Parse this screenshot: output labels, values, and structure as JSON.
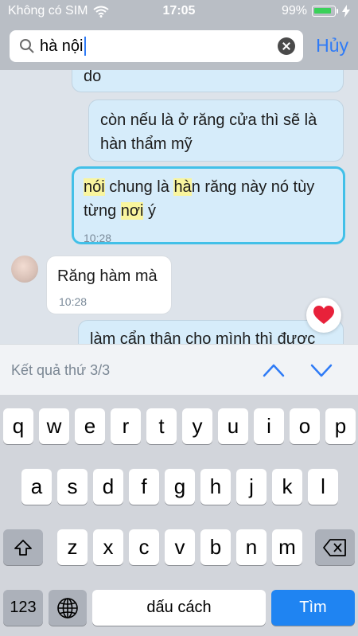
{
  "status": {
    "carrier": "Không có SIM",
    "time": "17:05",
    "battery": "99%"
  },
  "search": {
    "query": "hà nội",
    "cancel_label": "Hủy"
  },
  "messages": [
    {
      "side": "out",
      "text": "do"
    },
    {
      "side": "out",
      "text_line1": "còn nếu là ở răng cửa thì sẽ là",
      "text_line2": "hàn thẩm mỹ"
    },
    {
      "side": "out",
      "selected": true,
      "seg1": "nói",
      "seg2": " chung là ",
      "seg3": "hà",
      "seg4": "n răng này nó tùy",
      "seg5": "từng ",
      "seg6": "nơi",
      "seg7": " ý",
      "time": "10:28"
    },
    {
      "side": "in",
      "text": "Răng hàm mà",
      "time": "10:28"
    },
    {
      "side": "out",
      "text": "làm cẩn thận cho mình thì được"
    }
  ],
  "result_bar": {
    "text": "Kết quả thứ 3/3"
  },
  "keyboard": {
    "row1": [
      "q",
      "w",
      "e",
      "r",
      "t",
      "y",
      "u",
      "i",
      "o",
      "p"
    ],
    "row2": [
      "a",
      "s",
      "d",
      "f",
      "g",
      "h",
      "j",
      "k",
      "l"
    ],
    "row3": [
      "z",
      "x",
      "c",
      "v",
      "b",
      "n",
      "m"
    ],
    "numbers_label": "123",
    "space_label": "dấu cách",
    "search_label": "Tìm"
  },
  "colors": {
    "accent": "#2f7bf6",
    "highlight": "#f9f59e",
    "selected_border": "#42c0e8",
    "search_key": "#1f84f2"
  }
}
